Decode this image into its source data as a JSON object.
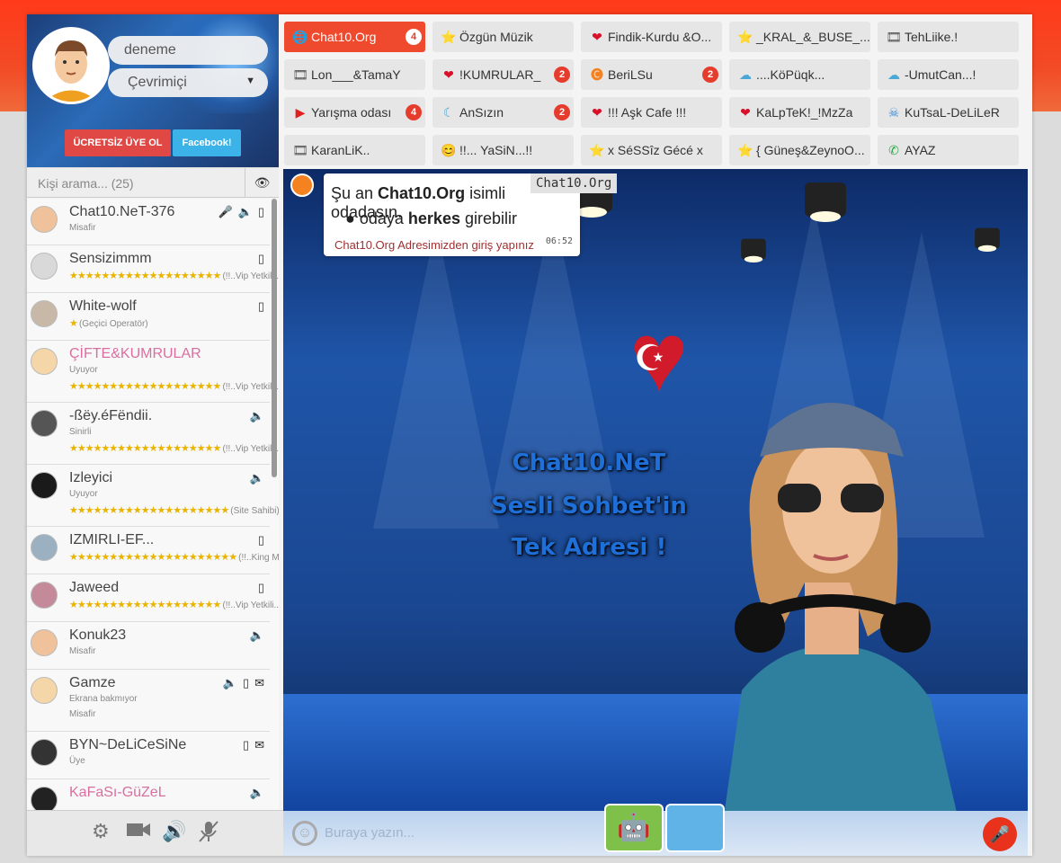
{
  "profile": {
    "username": "deneme",
    "status": "Çevrimiçi",
    "register_btn": "ÜCRETSİZ ÜYE OL",
    "facebook_btn": "Facebook!"
  },
  "search": {
    "placeholder": "Kişi arama... (25)"
  },
  "users": [
    {
      "name": "Chat10.NeT-376",
      "sub": "Misafir",
      "stars": "",
      "rank": "",
      "icons": [
        "mic",
        "speaker",
        "mobile"
      ],
      "color": "#444"
    },
    {
      "name": "Sensizimmm",
      "sub": "",
      "stars": "★★★★★★★★★★★★★★★★★★★",
      "rank": "(!!..Vip Yetkili...",
      "icons": [
        "mobile"
      ],
      "color": "#444"
    },
    {
      "name": "White-wolf",
      "sub": "",
      "stars": "★",
      "rank": "(Geçici Operatör)",
      "icons": [
        "mobile"
      ],
      "color": "#444"
    },
    {
      "name": "ÇİFTE&KUMRULAR",
      "sub": "Uyuyor",
      "stars": "★★★★★★★★★★★★★★★★★★★",
      "rank": "(!!..Vip Yetkili...",
      "icons": [],
      "color": "#d86fa0"
    },
    {
      "name": "-ßëy.éFëndii.",
      "sub": "Sinirli",
      "stars": "★★★★★★★★★★★★★★★★★★★",
      "rank": "(!!..Vip Yetkili...",
      "icons": [
        "speaker"
      ],
      "color": "#444"
    },
    {
      "name": "Izleyici",
      "sub": "Uyuyor",
      "stars": "★★★★★★★★★★★★★★★★★★★★",
      "rank": "(Site Sahibi)",
      "icons": [
        "speaker"
      ],
      "color": "#444"
    },
    {
      "name": "IZMIRLI-EF...",
      "sub": "",
      "stars": "★★★★★★★★★★★★★★★★★★★★★",
      "rank": "(!!..King Mana...",
      "icons": [
        "mobile"
      ],
      "color": "#444"
    },
    {
      "name": "Jaweed",
      "sub": "",
      "stars": "★★★★★★★★★★★★★★★★★★★",
      "rank": "(!!..Vip Yetkili...",
      "icons": [
        "mobile"
      ],
      "color": "#444"
    },
    {
      "name": "Konuk23",
      "sub": "Misafir",
      "stars": "",
      "rank": "",
      "icons": [
        "speaker"
      ],
      "color": "#444"
    },
    {
      "name": "Gamze",
      "sub": "Ekrana bakmıyor",
      "sub2": "Misafir",
      "stars": "",
      "rank": "",
      "icons": [
        "speaker",
        "mobile",
        "msg"
      ],
      "color": "#444"
    },
    {
      "name": "BYN~DeLiCeSiNe",
      "sub": "Üye",
      "stars": "",
      "rank": "",
      "icons": [
        "mobile",
        "msg"
      ],
      "color": "#444"
    },
    {
      "name": "KaFaSı-GüZeL",
      "sub": "",
      "stars": "",
      "rank": "",
      "icons": [
        "speaker"
      ],
      "color": "#d86fa0"
    }
  ],
  "rooms": [
    {
      "name": "Chat10.Org",
      "badge": "4",
      "icon": "globe"
    },
    {
      "name": "Özgün Müzik",
      "badge": "",
      "icon": "star"
    },
    {
      "name": "Findik-Kurdu &O...",
      "badge": "",
      "icon": "heart"
    },
    {
      "name": "_KRAL_&_BUSE_...",
      "badge": "",
      "icon": "star"
    },
    {
      "name": "TehLiike.!",
      "badge": "",
      "icon": "film"
    },
    {
      "name": "Lon___&TamaY",
      "badge": "",
      "icon": "film"
    },
    {
      "name": "!KUMRULAR_",
      "badge": "2",
      "icon": "heart"
    },
    {
      "name": "BeriLSu",
      "badge": "2",
      "icon": "logo"
    },
    {
      "name": "....KöPüqk...",
      "badge": "",
      "icon": "cloud"
    },
    {
      "name": "-UmutCan...!",
      "badge": "",
      "icon": "cloud"
    },
    {
      "name": "Yarışma odası",
      "badge": "4",
      "icon": "youtube"
    },
    {
      "name": "AnSızın",
      "badge": "2",
      "icon": "moon"
    },
    {
      "name": "!!! Aşk Cafe !!!",
      "badge": "",
      "icon": "heart"
    },
    {
      "name": "KaLpTeK!_!MzZa",
      "badge": "",
      "icon": "heart"
    },
    {
      "name": "KuTsaL-DeLiLeR",
      "badge": "",
      "icon": "skull"
    },
    {
      "name": "KaranLiK..",
      "badge": "",
      "icon": "film"
    },
    {
      "name": "!!... YaSiN...!!",
      "badge": "",
      "icon": "smiley"
    },
    {
      "name": "x SéSSîz Gécé x",
      "badge": "",
      "icon": "star"
    },
    {
      "name": "{ Güneş&ZeynoO...",
      "badge": "",
      "icon": "star"
    },
    {
      "name": "AYAZ",
      "badge": "",
      "icon": "whatsapp"
    }
  ],
  "room_tooltip": {
    "prefix": "Şu an ",
    "room": "Chat10.Org",
    "suffix": " isimli odadasın.",
    "bullet_prefix": "odaya ",
    "bullet_bold": "herkes",
    "bullet_suffix": " girebilir",
    "footer": "Chat10.Org Adresimizden giriş yapınız",
    "time": "06:52",
    "tag": "Chat10.Org"
  },
  "stage": {
    "slogan1": "Chat10.NeT",
    "slogan2": "Sesli Sohbet'in",
    "slogan3": "Tek Adresi !"
  },
  "message": {
    "placeholder": "Buraya yazın..."
  },
  "colors": {
    "accent": "#f04a2e",
    "badge": "#e53c2d",
    "speaker": "#3ab53a",
    "mic": "#9b2fd6"
  }
}
